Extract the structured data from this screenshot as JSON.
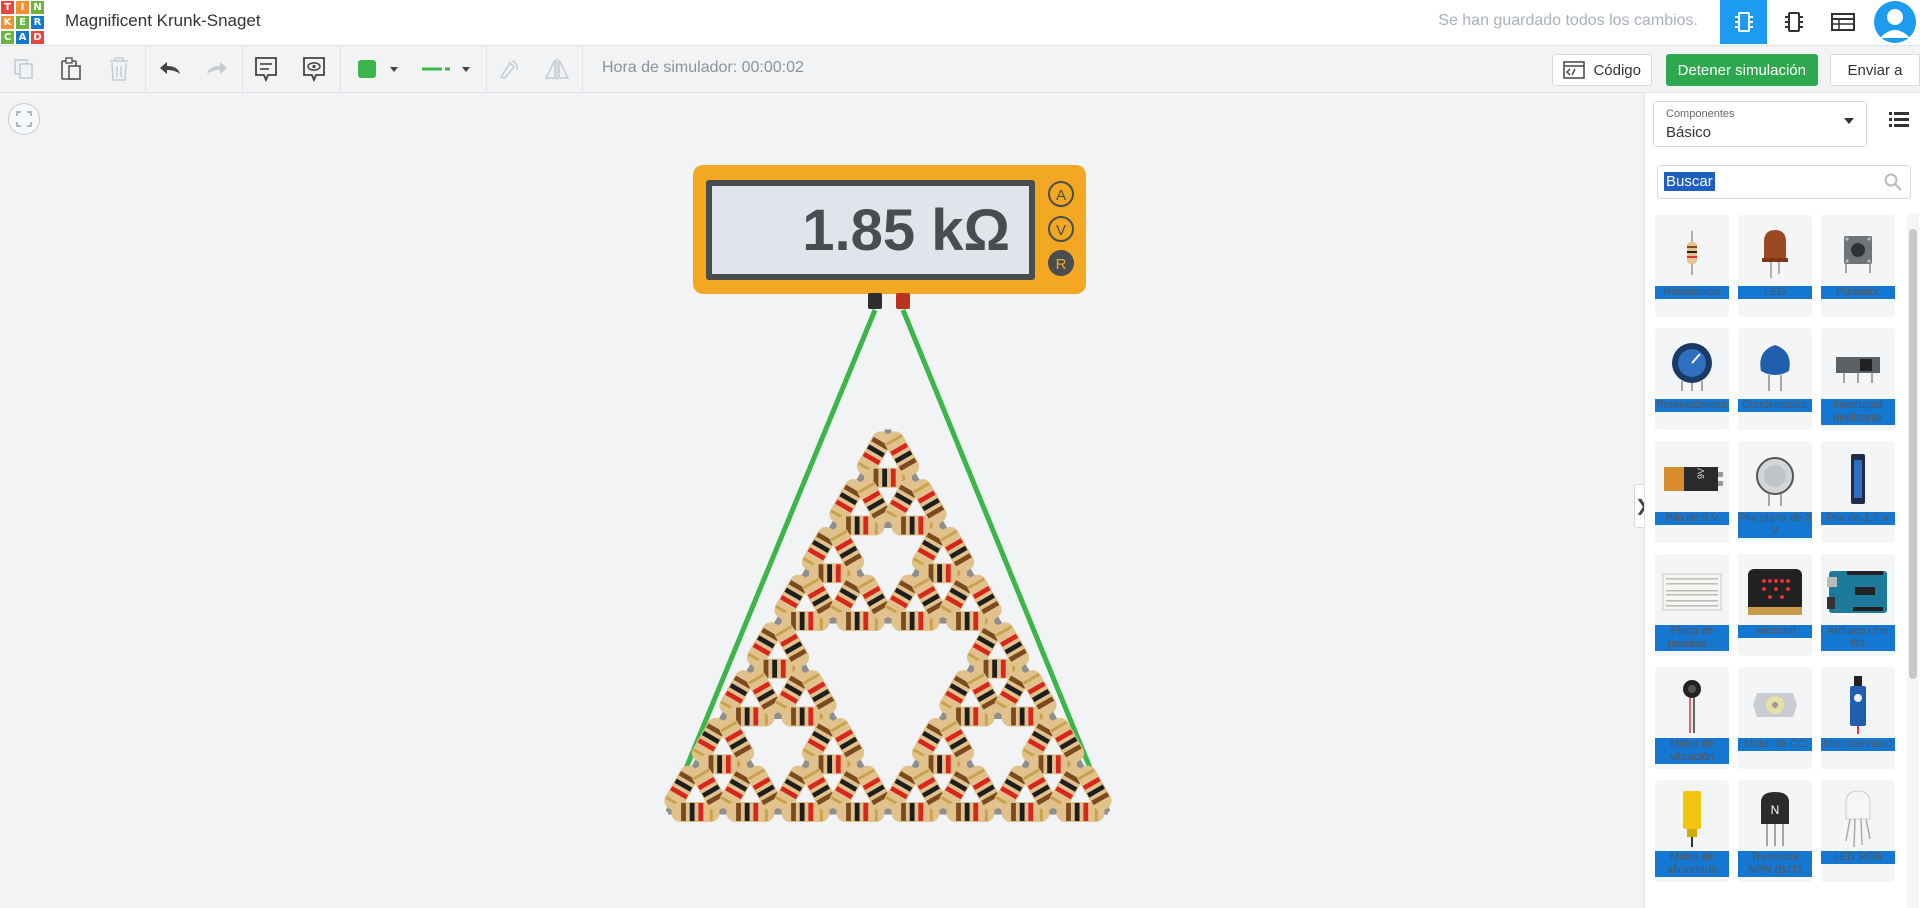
{
  "header": {
    "logo_letters": [
      "T",
      "I",
      "N",
      "K",
      "E",
      "R",
      "C",
      "A",
      "D"
    ],
    "doc_title": "Magnificent Krunk-Snaget",
    "save_status": "Se han guardado todos los cambios."
  },
  "toolbar": {
    "sim_time": "Hora de simulador: 00:00:02",
    "code_label": "Código",
    "stop_label": "Detener simulación",
    "send_label": "Enviar a",
    "wire_color": "#3cb54a"
  },
  "multimeter": {
    "reading": "1.85 kΩ",
    "modes": [
      "A",
      "V",
      "R"
    ],
    "active_mode": "R"
  },
  "panel": {
    "select_label": "Componentes",
    "select_value": "Básico",
    "search_value": "Buscar",
    "components": [
      {
        "label": "Resistencia",
        "icon": "resistor-icon"
      },
      {
        "label": "LED",
        "icon": "led-icon"
      },
      {
        "label": "Pulsador",
        "icon": "pushbutton-icon"
      },
      {
        "label": "Potenciómetro",
        "icon": "potentiometer-icon"
      },
      {
        "label": "Condensador",
        "icon": "capacitor-icon"
      },
      {
        "label": "Interruptor deslizante",
        "icon": "slide-switch-icon"
      },
      {
        "label": "Pila de 9 V",
        "icon": "battery-9v-icon"
      },
      {
        "label": "Pila plana de 3 V",
        "icon": "coin-cell-icon"
      },
      {
        "label": "Pila de 1,5 V",
        "icon": "battery-aa-icon"
      },
      {
        "label": "Placa de pruebas...",
        "icon": "breadboard-icon"
      },
      {
        "label": "micro:bit",
        "icon": "microbit-icon"
      },
      {
        "label": "Arduino Uno R3",
        "icon": "arduino-icon"
      },
      {
        "label": "Motor de vibración",
        "icon": "vibration-motor-icon"
      },
      {
        "label": "Motor de CC",
        "icon": "dc-motor-icon"
      },
      {
        "label": "Microservomo",
        "icon": "servo-icon"
      },
      {
        "label": "Motor de aficionado",
        "icon": "hobby-motor-icon"
      },
      {
        "label": "Transistor NPN (BJT)",
        "icon": "transistor-icon"
      },
      {
        "label": "LED RGB",
        "icon": "rgb-led-icon"
      }
    ]
  }
}
